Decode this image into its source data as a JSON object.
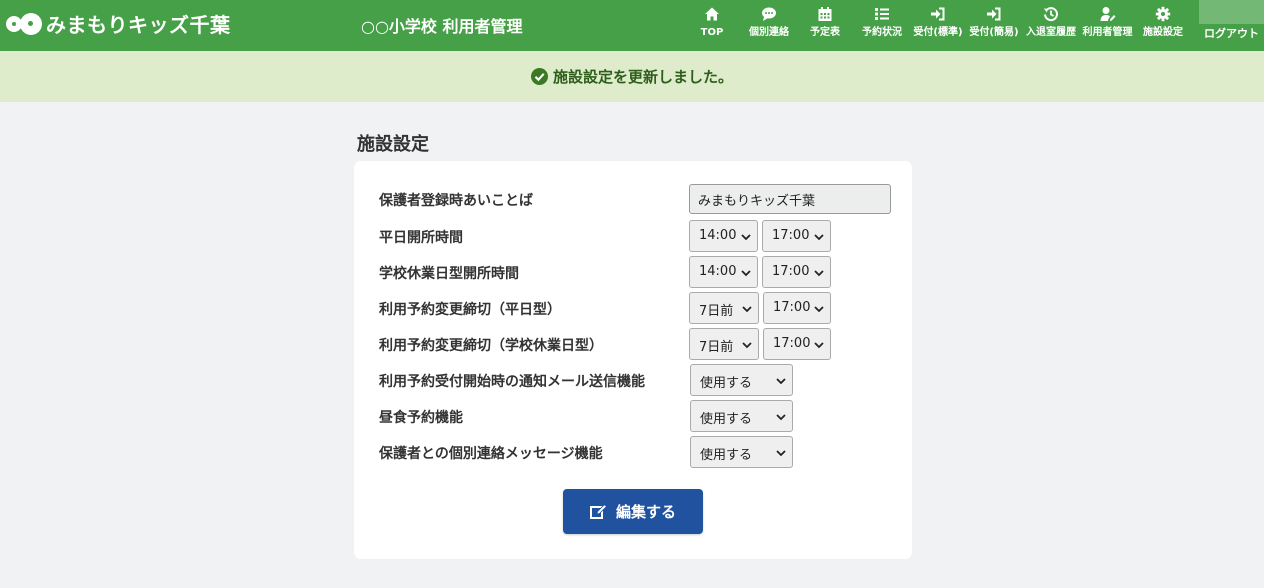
{
  "header": {
    "app_name": "みまもりキッズ千葉",
    "page_heading": "○○小学校 利用者管理",
    "nav": [
      {
        "label": "TOP",
        "icon": "home-icon"
      },
      {
        "label": "個別連絡",
        "icon": "chat-icon"
      },
      {
        "label": "予定表",
        "icon": "calendar-icon"
      },
      {
        "label": "予約状況",
        "icon": "list-icon"
      },
      {
        "label": "受付(標準)",
        "icon": "sign-in-icon"
      },
      {
        "label": "受付(簡易)",
        "icon": "sign-in-icon"
      },
      {
        "label": "入退室履歴",
        "icon": "history-icon"
      },
      {
        "label": "利用者管理",
        "icon": "user-edit-icon"
      },
      {
        "label": "施設設定",
        "icon": "gear-icon"
      }
    ],
    "logout_label": "ログアウト"
  },
  "alert": {
    "message": "施設設定を更新しました。",
    "icon": "check-circle-icon",
    "color": "#2f5e1c"
  },
  "section_title": "施設設定",
  "form": {
    "passphrase": {
      "label": "保護者登録時あいことば",
      "value": "みまもりキッズ千葉"
    },
    "weekday_hours": {
      "label": "平日開所時間",
      "start": "14:00",
      "end": "17:00"
    },
    "holiday_hours": {
      "label": "学校休業日型開所時間",
      "start": "14:00",
      "end": "17:00"
    },
    "weekday_deadline": {
      "label": "利用予約変更締切（平日型）",
      "days": "7日前",
      "time": "17:00"
    },
    "holiday_deadline": {
      "label": "利用予約変更締切（学校休業日型）",
      "days": "7日前",
      "time": "17:00"
    },
    "notify_mail": {
      "label": "利用予約受付開始時の通知メール送信機能",
      "value": "使用する"
    },
    "lunch": {
      "label": "昼食予約機能",
      "value": "使用する"
    },
    "message": {
      "label": "保護者との個別連絡メッセージ機能",
      "value": "使用する"
    }
  },
  "edit_button": {
    "label": "編集する",
    "icon": "edit-icon"
  },
  "colors": {
    "header_bg": "#46a047",
    "alert_bg": "#dfeccc",
    "button_bg": "#2152a0",
    "page_bg": "#f1f2f4"
  }
}
